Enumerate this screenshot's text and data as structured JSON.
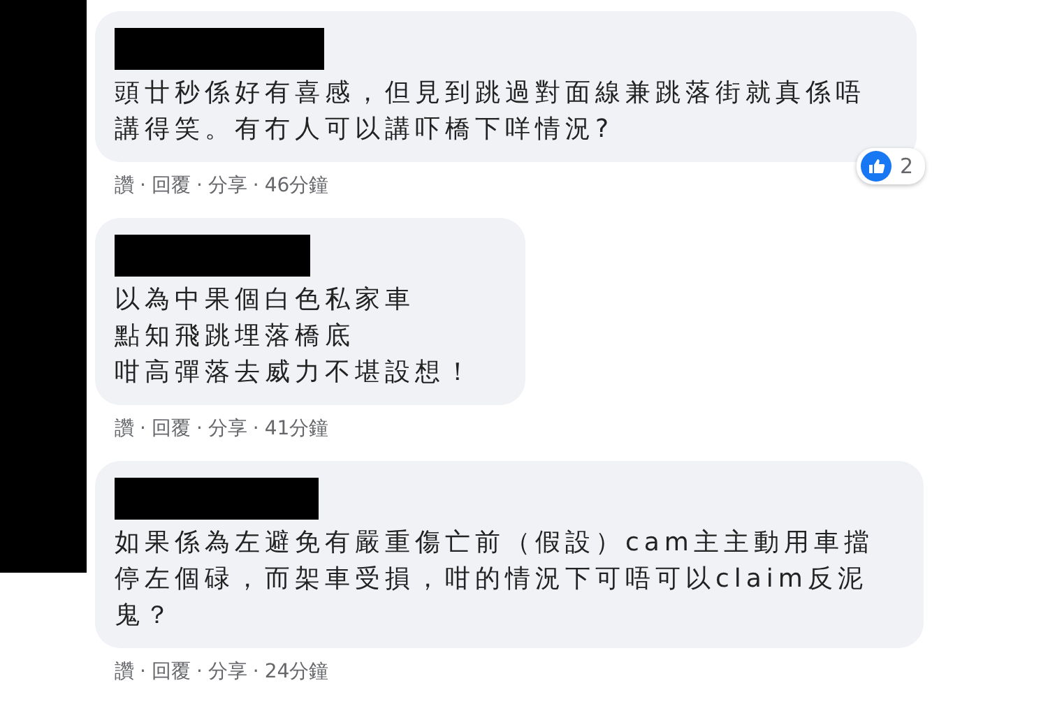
{
  "comments": [
    {
      "lines": [
        "頭廿秒係好有喜感，但見到跳過對面線兼跳落街就真係唔",
        "講得笑。有冇人可以講吓橋下咩情況?"
      ],
      "actions": [
        "讚",
        "回覆",
        "分享"
      ],
      "separator": "·",
      "time": "46分鐘",
      "reactions": {
        "count": "2"
      }
    },
    {
      "lines": [
        "以為中果個白色私家車",
        "點知飛跳埋落橋底",
        "咁高彈落去威力不堪設想！"
      ],
      "actions": [
        "讚",
        "回覆",
        "分享"
      ],
      "separator": "·",
      "time": "41分鐘"
    },
    {
      "lines": [
        "如果係為左避免有嚴重傷亡前（假設）cam主主動用車擋",
        "停左個碌，而架車受損，咁的情況下可唔可以claim反泥",
        "鬼？"
      ],
      "actions": [
        "讚",
        "回覆",
        "分享"
      ],
      "separator": "·",
      "time": "24分鐘"
    }
  ]
}
